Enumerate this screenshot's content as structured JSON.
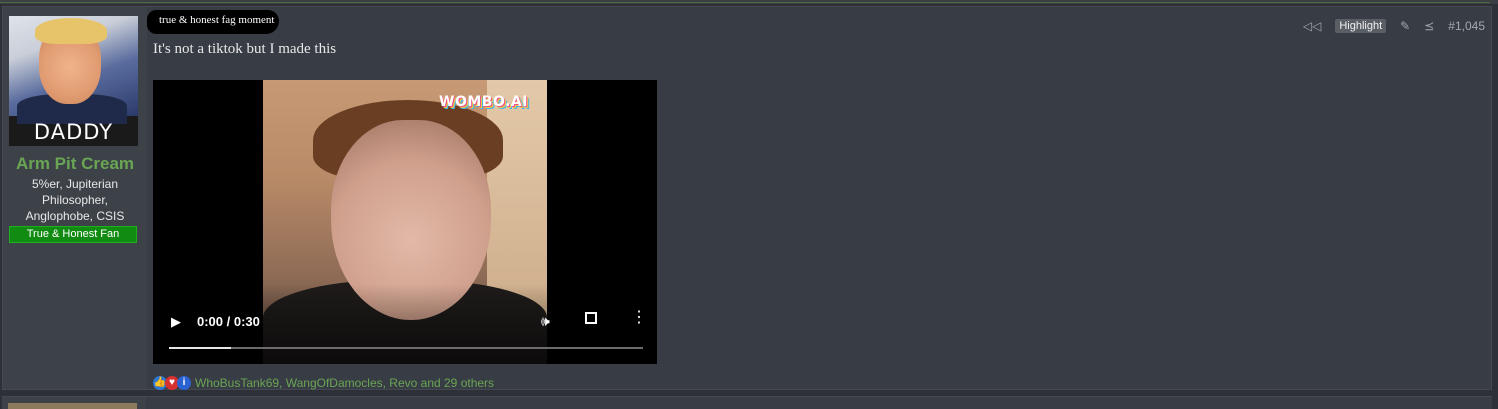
{
  "post": {
    "author": {
      "avatar_caption": "DADDY",
      "name": "Arm Pit Cream",
      "title": "5%er, Jupiterian Philosopher, Anglophobe, CSIS",
      "banner": "True & Honest Fan"
    },
    "tag_text": "true & honest fag moment",
    "actions": {
      "highlight_label": "Highlight",
      "post_number": "#1,045",
      "icons": [
        "rewind-icon",
        "edit-icon",
        "share-icon"
      ]
    },
    "message": "It's not a tiktok but I made this",
    "video": {
      "watermark": "WOMBO.AI",
      "time": "0:00 / 0:30",
      "progress": 0.13
    },
    "reactions": {
      "icons": [
        "like-icon",
        "heart-icon",
        "info-icon"
      ],
      "text": "WhoBusTank69, WangOfDamocles, Revo and 29 others"
    }
  }
}
